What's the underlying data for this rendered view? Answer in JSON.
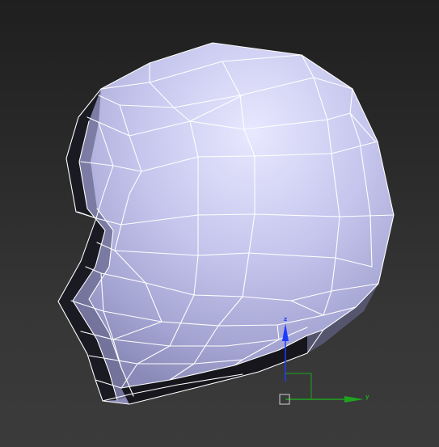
{
  "viewport": {
    "object": "head-mesh",
    "colors": {
      "background_top": "#1f1f1f",
      "background_bottom": "#3b3b3b",
      "mesh_base": "#b9b9e8",
      "mesh_highlight": "#e6e6ff",
      "mesh_shadow": "#141418",
      "wireframe": "#ffffff"
    }
  },
  "gizmo": {
    "z_label": "z",
    "y_label": "y",
    "colors": {
      "z": "#1e3cff",
      "y": "#1fa31f"
    }
  }
}
